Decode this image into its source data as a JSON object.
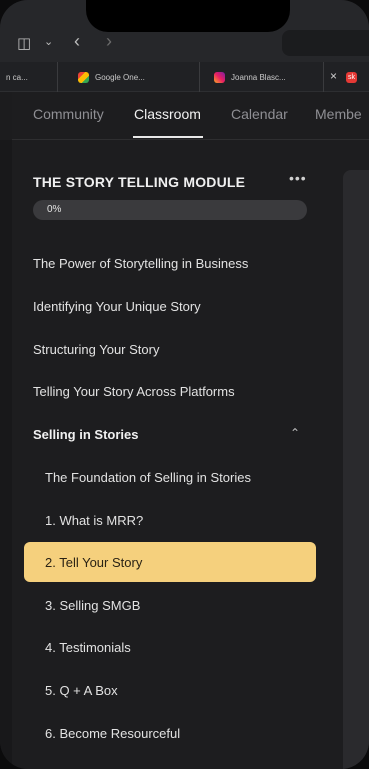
{
  "browser": {
    "tabs": [
      {
        "label": "n ca..."
      },
      {
        "label": "Google One..."
      },
      {
        "label": "Joanna Blasc..."
      }
    ],
    "active_tab_short": "sk"
  },
  "nav": {
    "items": [
      {
        "label": "Community"
      },
      {
        "label": "Classroom"
      },
      {
        "label": "Calendar"
      },
      {
        "label": "Membe"
      }
    ]
  },
  "module": {
    "title": "THE STORY TELLING MODULE",
    "progress_label": "0%",
    "progress": 0,
    "lessons": [
      {
        "label": "The Power of Storytelling in Business"
      },
      {
        "label": "Identifying Your Unique Story"
      },
      {
        "label": "Structuring Your Story"
      },
      {
        "label": "Telling Your Story Across Platforms"
      }
    ],
    "section": {
      "label": "Selling in Stories",
      "items": [
        {
          "label": "The Foundation of Selling in Stories"
        },
        {
          "label": "1. What is MRR?"
        },
        {
          "label": "2. Tell Your Story"
        },
        {
          "label": "3. Selling SMGB"
        },
        {
          "label": "4. Testimonials"
        },
        {
          "label": "5. Q + A Box"
        },
        {
          "label": "6. Become Resourceful"
        }
      ],
      "selected_index": 2
    }
  },
  "colors": {
    "accent": "#f5d07d",
    "background": "#1d1d1f"
  }
}
